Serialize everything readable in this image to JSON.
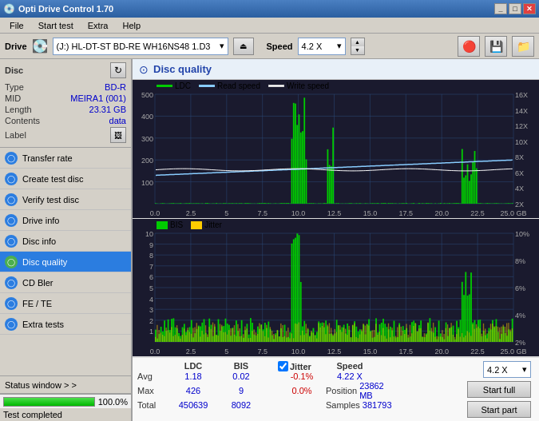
{
  "titlebar": {
    "title": "Opti Drive Control 1.70",
    "icon": "⚙"
  },
  "menu": {
    "items": [
      "File",
      "Start test",
      "Extra",
      "Help"
    ]
  },
  "drivebar": {
    "drive_label": "Drive",
    "drive_value": "(J:)  HL-DT-ST BD-RE  WH16NS48 1.D3",
    "speed_label": "Speed",
    "speed_value": "4.2 X"
  },
  "disc_panel": {
    "label": "Disc",
    "fields": [
      {
        "key": "Type",
        "value": "BD-R"
      },
      {
        "key": "MID",
        "value": "MEIRA1 (001)"
      },
      {
        "key": "Length",
        "value": "23.31 GB"
      },
      {
        "key": "Contents",
        "value": "data"
      },
      {
        "key": "Label",
        "value": ""
      }
    ]
  },
  "nav": {
    "items": [
      {
        "id": "transfer-rate",
        "label": "Transfer rate",
        "icon": "⟳",
        "color": "blue",
        "active": false
      },
      {
        "id": "create-test-disc",
        "label": "Create test disc",
        "icon": "◉",
        "color": "blue",
        "active": false
      },
      {
        "id": "verify-test-disc",
        "label": "Verify test disc",
        "icon": "✓",
        "color": "blue",
        "active": false
      },
      {
        "id": "drive-info",
        "label": "Drive info",
        "icon": "ℹ",
        "color": "blue",
        "active": false
      },
      {
        "id": "disc-info",
        "label": "Disc info",
        "icon": "◎",
        "color": "blue",
        "active": false
      },
      {
        "id": "disc-quality",
        "label": "Disc quality",
        "icon": "★",
        "color": "green",
        "active": true
      },
      {
        "id": "cd-bler",
        "label": "CD Bler",
        "icon": "◈",
        "color": "blue",
        "active": false
      },
      {
        "id": "fe-te",
        "label": "FE / TE",
        "icon": "◆",
        "color": "blue",
        "active": false
      },
      {
        "id": "extra-tests",
        "label": "Extra tests",
        "icon": "⊕",
        "color": "blue",
        "active": false
      }
    ]
  },
  "status_window": {
    "label": "Status window > >"
  },
  "chart": {
    "title": "Disc quality",
    "upper_legend": [
      {
        "label": "LDC",
        "color": "#00cc00"
      },
      {
        "label": "Read speed",
        "color": "#88ccff"
      },
      {
        "label": "Write speed",
        "color": "#ffffff"
      }
    ],
    "lower_legend": [
      {
        "label": "BIS",
        "color": "#00cc00"
      },
      {
        "label": "Jitter",
        "color": "#ffcc00"
      }
    ],
    "upper_y_max": 500,
    "upper_y_labels": [
      "500",
      "400",
      "300",
      "200",
      "100"
    ],
    "upper_y_right": [
      "16X",
      "14X",
      "12X",
      "10X",
      "8X",
      "6X",
      "4X",
      "2X"
    ],
    "lower_y_max": 10,
    "lower_y_labels": [
      "10",
      "9",
      "8",
      "7",
      "6",
      "5",
      "4",
      "3",
      "2",
      "1"
    ],
    "lower_y_right": [
      "10%",
      "8%",
      "6%",
      "4%",
      "2%"
    ],
    "x_labels": [
      "0.0",
      "2.5",
      "5.0",
      "7.5",
      "10.0",
      "12.5",
      "15.0",
      "17.5",
      "20.0",
      "22.5",
      "25.0 GB"
    ]
  },
  "stats": {
    "col_headers": [
      "LDC",
      "BIS",
      "",
      "Jitter",
      "Speed"
    ],
    "avg": {
      "ldc": "1.18",
      "bis": "0.02",
      "jitter": "-0.1%",
      "jitter_color": "red"
    },
    "max": {
      "ldc": "426",
      "bis": "9",
      "jitter": "0.0%",
      "jitter_color": "red"
    },
    "total": {
      "ldc": "450639",
      "bis": "8092"
    },
    "speed": {
      "avg": "4.22 X",
      "position": "23862 MB",
      "samples": "381793"
    },
    "speed_selector": "4.2 X",
    "jitter_checked": true
  },
  "buttons": {
    "start_full": "Start full",
    "start_part": "Start part"
  },
  "bottom": {
    "status": "Test completed",
    "progress": 100,
    "progress_text": "100.0%"
  }
}
